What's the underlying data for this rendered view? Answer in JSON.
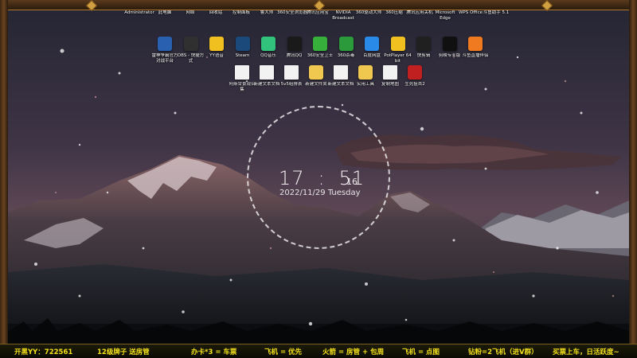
{
  "desktop": {
    "icons_row1": [
      {
        "label": "Administrator",
        "icon": "user-folder-icon",
        "color": "#e8b84a"
      },
      {
        "label": "此电脑",
        "icon": "computer-icon",
        "color": "#4a90d9"
      },
      {
        "label": "网络",
        "icon": "network-icon",
        "color": "#4a90d9"
      },
      {
        "label": "回收站",
        "icon": "recycle-bin-icon",
        "color": "#9aa8b8"
      },
      {
        "label": "控制面板",
        "icon": "control-panel-icon",
        "color": "#3a7ad0"
      },
      {
        "label": "鲁大师",
        "icon": "ludashi-icon",
        "color": "#2a7ae0"
      },
      {
        "label": "360安全浏览器",
        "icon": "browser-360-icon",
        "color": "#2aa84a"
      },
      {
        "label": "腾讯应用宝",
        "icon": "app-store-icon",
        "color": "#f0a020"
      },
      {
        "label": "NVIDIA Broadcast",
        "icon": "nvidia-icon",
        "color": "#76b900"
      },
      {
        "label": "360驱动大师",
        "icon": "driver-icon",
        "color": "#2a8ae0"
      },
      {
        "label": "360压缩",
        "icon": "zip-icon",
        "color": "#2a6ad0"
      },
      {
        "label": "腾讯应用关机",
        "icon": "shutdown-icon",
        "color": "#3a6ae0"
      },
      {
        "label": "Microsoft Edge",
        "icon": "edge-icon",
        "color": "#1e8fd8"
      },
      {
        "label": "WPS Office",
        "icon": "wps-icon",
        "color": "#d83a2a"
      },
      {
        "label": "斗鱼助手 5.1",
        "icon": "douyu-icon",
        "color": "#f06a20"
      }
    ],
    "icons_row2": [
      {
        "label": "雷神争霸官方对战平台",
        "icon": "game-platform-icon",
        "color": "#2a60b0"
      },
      {
        "label": "OBS - 快捷方式",
        "icon": "obs-icon",
        "color": "#303030"
      },
      {
        "label": "YY语音",
        "icon": "yy-icon",
        "color": "#f0c020"
      },
      {
        "label": "Steam",
        "icon": "steam-icon",
        "color": "#1b4a7a"
      },
      {
        "label": "QQ音乐",
        "icon": "qq-music-icon",
        "color": "#31c27c"
      },
      {
        "label": "腾讯QQ",
        "icon": "qq-icon",
        "color": "#1a1a1a"
      },
      {
        "label": "360安全卫士",
        "icon": "shield-360-icon",
        "color": "#36b03a"
      },
      {
        "label": "360杀毒",
        "icon": "antivirus-icon",
        "color": "#2a9a3a"
      },
      {
        "label": "百度网盘",
        "icon": "baidu-cloud-icon",
        "color": "#2a8ae8"
      },
      {
        "label": "PotPlayer 64 bit",
        "icon": "potplayer-icon",
        "color": "#f0c020"
      },
      {
        "label": "快剪辑",
        "icon": "video-edit-icon",
        "color": "#202020"
      },
      {
        "label": "剪映专业版",
        "icon": "capcut-icon",
        "color": "#101010"
      },
      {
        "label": "斗鱼直播伴侣",
        "icon": "live-companion-icon",
        "color": "#f07a20"
      }
    ],
    "icons_row3": [
      {
        "label": "阿斯甘景观合集",
        "icon": "document-icon",
        "color": "#f2f2f2"
      },
      {
        "label": "新建文本文档",
        "icon": "document-icon",
        "color": "#f2f2f2"
      },
      {
        "label": "5v5组排表",
        "icon": "document-icon",
        "color": "#f2f2f2"
      },
      {
        "label": "新建文件夹",
        "icon": "folder-icon",
        "color": "#f0c850"
      },
      {
        "label": "新建文本文档",
        "icon": "document-icon",
        "color": "#f2f2f2"
      },
      {
        "label": "实用工具",
        "icon": "folder-icon",
        "color": "#f0c850"
      },
      {
        "label": "复制地图",
        "icon": "document-icon",
        "color": "#f2f2f2"
      },
      {
        "label": "生死狙击2",
        "icon": "game-icon",
        "color": "#c02020"
      }
    ]
  },
  "clock": {
    "hour": "17",
    "minute": "51",
    "second": "16",
    "date": "2022/11/29 Tuesday"
  },
  "bottom_bar": {
    "items": [
      "开黑YY：722561",
      "12级牌子 送房管",
      "办卡*3 = 车票",
      "飞机 = 优先",
      "火箭 = 房管 + 包周",
      "飞机 = 点图",
      "钻粉=2飞机（进V群）",
      "买票上车，日活跃度~"
    ]
  }
}
